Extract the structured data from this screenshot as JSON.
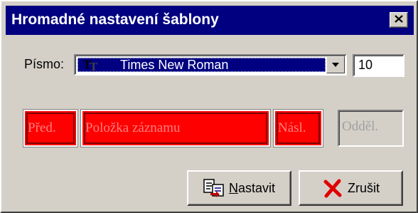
{
  "window": {
    "title": "Hromadné nastavení šablony",
    "close_glyph": "✕"
  },
  "font": {
    "label": "Písmo:",
    "selected": "Times New Roman",
    "size": "10",
    "icon": "truetype-font-icon"
  },
  "fields": {
    "prev": "Před.",
    "record_item": "Položka záznamu",
    "next": "Násl.",
    "separator": "Odděl."
  },
  "buttons": {
    "set_mnemonic": "N",
    "set_rest": "astavit",
    "cancel": "Zrušit"
  },
  "colors": {
    "titlebar": "#000080",
    "field_red": "#ff0000",
    "face": "#d4d0c8"
  }
}
